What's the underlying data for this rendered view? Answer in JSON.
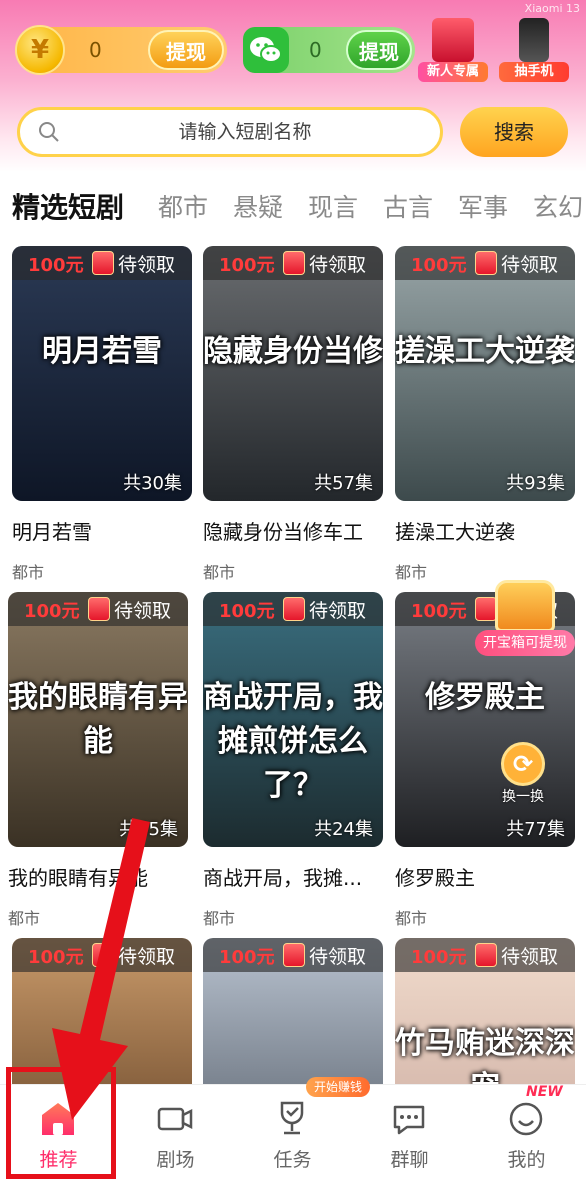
{
  "watermark": "Xiaomi 13",
  "header": {
    "coin": {
      "icon": "yuan-coin-icon",
      "symbol": "¥",
      "value": "0",
      "button": "提现"
    },
    "wechat": {
      "icon": "wechat-icon",
      "value": "0",
      "button": "提现"
    },
    "promos": [
      {
        "label": "新人专属",
        "icon": "red-envelope-icon"
      },
      {
        "label": "抽手机",
        "icon": "phone-icon"
      }
    ]
  },
  "search": {
    "placeholder": "请输入短剧名称",
    "button": "搜索"
  },
  "tabs": [
    "精选短剧",
    "都市",
    "悬疑",
    "现言",
    "古言",
    "军事",
    "玄幻"
  ],
  "badge": {
    "amount": "100元",
    "status": "待领取"
  },
  "cards": [
    {
      "title": "明月若雪",
      "genre": "都市",
      "episodes": "共30集",
      "poster_text": "明月若雪",
      "colors": [
        "#2b3a55",
        "#0e1626"
      ]
    },
    {
      "title": "隐藏身份当修车工",
      "genre": "都市",
      "episodes": "共57集",
      "poster_text": "隐藏身份当修",
      "colors": [
        "#6a6d70",
        "#23272b"
      ]
    },
    {
      "title": "搓澡工大逆袭",
      "genre": "都市",
      "episodes": "共93集",
      "poster_text": "搓澡工大逆袭",
      "colors": [
        "#9aa7a9",
        "#3d4a4c"
      ]
    },
    {
      "title": "我的眼睛有异能",
      "genre": "都市",
      "episodes": "共65集",
      "poster_text": "我的眼睛有异能",
      "colors": [
        "#8b7a62",
        "#3a3124"
      ]
    },
    {
      "title": "商战开局，我摊...",
      "genre": "都市",
      "episodes": "共24集",
      "poster_text": "商战开局，我摊煎饼怎么了？",
      "colors": [
        "#3a6f80",
        "#1c2b2f"
      ]
    },
    {
      "title": "修罗殿主",
      "genre": "都市",
      "episodes": "共77集",
      "poster_text": "修罗殿主",
      "colors": [
        "#7a7f86",
        "#1e1f22"
      ]
    },
    {
      "title": "",
      "genre": "",
      "episodes": "",
      "poster_text": "",
      "colors": [
        "#c99a6a",
        "#5a3a20"
      ]
    },
    {
      "title": "",
      "genre": "",
      "episodes": "",
      "poster_text": "",
      "colors": [
        "#b9c3d0",
        "#4d5560"
      ]
    },
    {
      "title": "",
      "genre": "",
      "episodes": "",
      "poster_text": "竹马贿迷深深宠",
      "colors": [
        "#f1dccd",
        "#c7a59a"
      ]
    }
  ],
  "treasure": {
    "label": "开宝箱可提现"
  },
  "swap": {
    "label": "换一换"
  },
  "nav": [
    {
      "label": "推荐",
      "icon": "home-icon",
      "active": true
    },
    {
      "label": "剧场",
      "icon": "video-camera-icon"
    },
    {
      "label": "任务",
      "icon": "trophy-icon"
    },
    {
      "label": "群聊",
      "icon": "chat-bubble-icon"
    },
    {
      "label": "我的",
      "icon": "profile-icon"
    }
  ],
  "task_ribbon": "开始赚钱",
  "new_tag": "NEW",
  "colors": {
    "accent": "#ff2d6a",
    "search_border": "#ffd24a",
    "highlight": "#e6101a"
  }
}
